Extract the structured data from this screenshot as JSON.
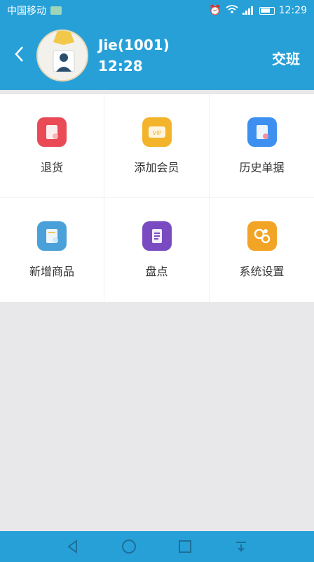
{
  "status": {
    "carrier": "中国移动",
    "time": "12:29"
  },
  "header": {
    "name": "Jie(1001)",
    "time": "12:28",
    "shift_button": "交班"
  },
  "menu": [
    {
      "label": "退货",
      "icon": "return-icon",
      "color": "#e94a56"
    },
    {
      "label": "添加会员",
      "icon": "vip-icon",
      "color": "#f3b42b"
    },
    {
      "label": "历史单据",
      "icon": "history-icon",
      "color": "#3d8ff0"
    },
    {
      "label": "新增商品",
      "icon": "add-product-icon",
      "color": "#4aa0d9"
    },
    {
      "label": "盘点",
      "icon": "inventory-icon",
      "color": "#7a4bc0"
    },
    {
      "label": "系统设置",
      "icon": "settings-icon",
      "color": "#f2a425"
    }
  ],
  "colors": {
    "primary": "#27a0d8",
    "background": "#e8e7ea"
  }
}
